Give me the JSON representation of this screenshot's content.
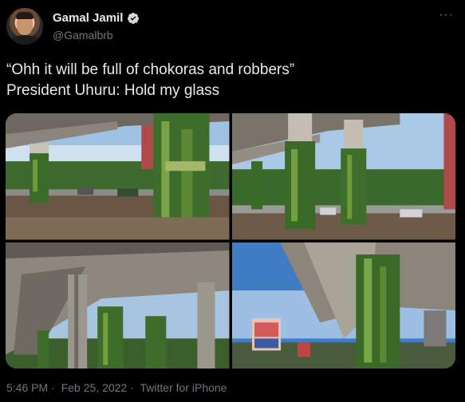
{
  "author": {
    "name": "Gamal Jamil",
    "handle": "@Gamalbrb",
    "avatar_icon": "avatar-photo",
    "verified_icon": "verified-badge-icon"
  },
  "more_icon": "more-options-icon",
  "tweet": {
    "line1": "“Ohh it will be full of chokoras and robbers”",
    "line2": "President Uhuru: Hold my glass"
  },
  "media": {
    "photos": [
      {
        "name": "photo-1"
      },
      {
        "name": "photo-2"
      },
      {
        "name": "photo-3"
      },
      {
        "name": "photo-4"
      }
    ]
  },
  "footer": {
    "time": "5:46 PM",
    "date": "Feb 25, 2022",
    "source": "Twitter for iPhone",
    "separator": "·"
  },
  "colors": {
    "background": "#000000",
    "text": "#e7e9ea",
    "muted": "#71767b",
    "verified": "#d9d9d9"
  }
}
